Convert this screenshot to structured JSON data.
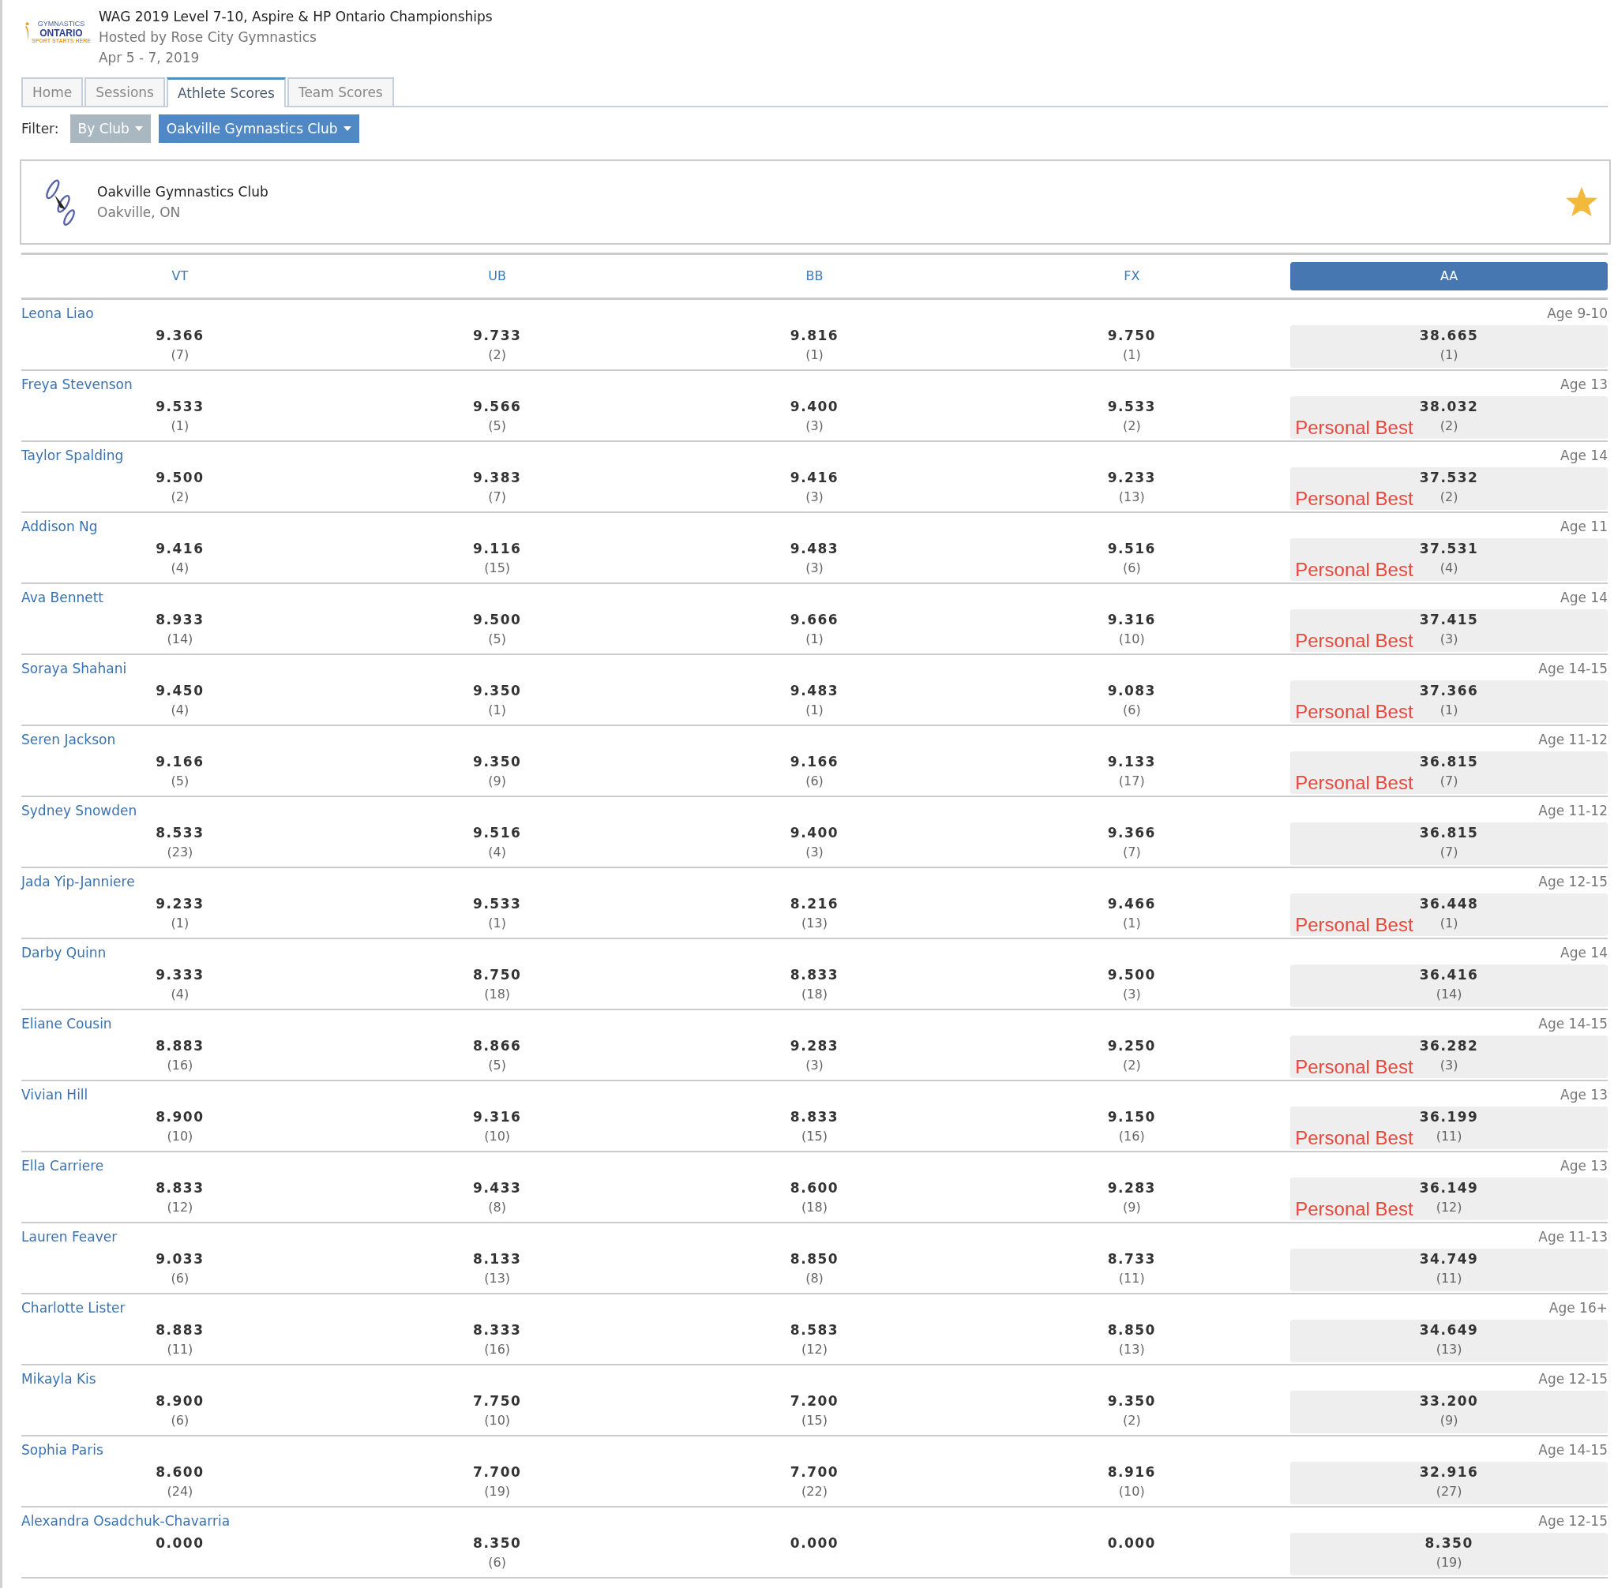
{
  "header": {
    "logo_lines": [
      "GYMNASTICS",
      "ONTARIO",
      "SPORT STARTS HERE"
    ],
    "title": "WAG 2019 Level 7-10, Aspire & HP Ontario Championships",
    "host": "Hosted by Rose City Gymnastics",
    "dates": "Apr 5 - 7, 2019"
  },
  "tabs": [
    {
      "label": "Home",
      "selected": false
    },
    {
      "label": "Sessions",
      "selected": false
    },
    {
      "label": "Athlete Scores",
      "selected": true
    },
    {
      "label": "Team Scores",
      "selected": false
    }
  ],
  "filter": {
    "label": "Filter:",
    "buttons": [
      {
        "label": "By Club",
        "kind": "secondary"
      },
      {
        "label": "Oakville Gymnastics Club",
        "kind": "primary"
      }
    ]
  },
  "club": {
    "name": "Oakville Gymnastics Club",
    "location": "Oakville, ON",
    "favorite": true
  },
  "columns": [
    {
      "label": "VT",
      "selected": false
    },
    {
      "label": "UB",
      "selected": false
    },
    {
      "label": "BB",
      "selected": false
    },
    {
      "label": "FX",
      "selected": false
    },
    {
      "label": "AA",
      "selected": true
    }
  ],
  "rows": [
    {
      "name": "Leona Liao",
      "age": "Age 9-10",
      "scores": [
        {
          "score": "9.366",
          "rank": "(7)"
        },
        {
          "score": "9.733",
          "rank": "(2)"
        },
        {
          "score": "9.816",
          "rank": "(1)"
        },
        {
          "score": "9.750",
          "rank": "(1)"
        }
      ],
      "aa": {
        "score": "38.665",
        "rank": "(1)"
      }
    },
    {
      "name": "Freya Stevenson",
      "age": "Age 13",
      "scores": [
        {
          "score": "9.533",
          "rank": "(1)"
        },
        {
          "score": "9.566",
          "rank": "(5)"
        },
        {
          "score": "9.400",
          "rank": "(3)"
        },
        {
          "score": "9.533",
          "rank": "(2)"
        }
      ],
      "aa": {
        "score": "38.032",
        "rank": "(2)"
      },
      "badge": "Personal Best"
    },
    {
      "name": "Taylor Spalding",
      "age": "Age 14",
      "scores": [
        {
          "score": "9.500",
          "rank": "(2)"
        },
        {
          "score": "9.383",
          "rank": "(7)"
        },
        {
          "score": "9.416",
          "rank": "(3)"
        },
        {
          "score": "9.233",
          "rank": "(13)"
        }
      ],
      "aa": {
        "score": "37.532",
        "rank": "(2)"
      },
      "badge": "Personal Best"
    },
    {
      "name": "Addison Ng",
      "age": "Age 11",
      "scores": [
        {
          "score": "9.416",
          "rank": "(4)"
        },
        {
          "score": "9.116",
          "rank": "(15)"
        },
        {
          "score": "9.483",
          "rank": "(3)"
        },
        {
          "score": "9.516",
          "rank": "(6)"
        }
      ],
      "aa": {
        "score": "37.531",
        "rank": "(4)"
      },
      "badge": "Personal Best"
    },
    {
      "name": "Ava Bennett",
      "age": "Age 14",
      "scores": [
        {
          "score": "8.933",
          "rank": "(14)"
        },
        {
          "score": "9.500",
          "rank": "(5)"
        },
        {
          "score": "9.666",
          "rank": "(1)"
        },
        {
          "score": "9.316",
          "rank": "(10)"
        }
      ],
      "aa": {
        "score": "37.415",
        "rank": "(3)"
      },
      "badge": "Personal Best"
    },
    {
      "name": "Soraya Shahani",
      "age": "Age 14-15",
      "scores": [
        {
          "score": "9.450",
          "rank": "(4)"
        },
        {
          "score": "9.350",
          "rank": "(1)"
        },
        {
          "score": "9.483",
          "rank": "(1)"
        },
        {
          "score": "9.083",
          "rank": "(6)"
        }
      ],
      "aa": {
        "score": "37.366",
        "rank": "(1)"
      },
      "badge": "Personal Best"
    },
    {
      "name": "Seren Jackson",
      "age": "Age 11-12",
      "scores": [
        {
          "score": "9.166",
          "rank": "(5)"
        },
        {
          "score": "9.350",
          "rank": "(9)"
        },
        {
          "score": "9.166",
          "rank": "(6)"
        },
        {
          "score": "9.133",
          "rank": "(17)"
        }
      ],
      "aa": {
        "score": "36.815",
        "rank": "(7)"
      },
      "badge": "Personal Best"
    },
    {
      "name": "Sydney Snowden",
      "age": "Age 11-12",
      "scores": [
        {
          "score": "8.533",
          "rank": "(23)"
        },
        {
          "score": "9.516",
          "rank": "(4)"
        },
        {
          "score": "9.400",
          "rank": "(3)"
        },
        {
          "score": "9.366",
          "rank": "(7)"
        }
      ],
      "aa": {
        "score": "36.815",
        "rank": "(7)"
      }
    },
    {
      "name": "Jada Yip-Janniere",
      "age": "Age 12-15",
      "scores": [
        {
          "score": "9.233",
          "rank": "(1)"
        },
        {
          "score": "9.533",
          "rank": "(1)"
        },
        {
          "score": "8.216",
          "rank": "(13)"
        },
        {
          "score": "9.466",
          "rank": "(1)"
        }
      ],
      "aa": {
        "score": "36.448",
        "rank": "(1)"
      },
      "badge": "Personal Best"
    },
    {
      "name": "Darby Quinn",
      "age": "Age 14",
      "scores": [
        {
          "score": "9.333",
          "rank": "(4)"
        },
        {
          "score": "8.750",
          "rank": "(18)"
        },
        {
          "score": "8.833",
          "rank": "(18)"
        },
        {
          "score": "9.500",
          "rank": "(3)"
        }
      ],
      "aa": {
        "score": "36.416",
        "rank": "(14)"
      }
    },
    {
      "name": "Eliane Cousin",
      "age": "Age 14-15",
      "scores": [
        {
          "score": "8.883",
          "rank": "(16)"
        },
        {
          "score": "8.866",
          "rank": "(5)"
        },
        {
          "score": "9.283",
          "rank": "(3)"
        },
        {
          "score": "9.250",
          "rank": "(2)"
        }
      ],
      "aa": {
        "score": "36.282",
        "rank": "(3)"
      },
      "badge": "Personal Best"
    },
    {
      "name": "Vivian Hill",
      "age": "Age 13",
      "scores": [
        {
          "score": "8.900",
          "rank": "(10)"
        },
        {
          "score": "9.316",
          "rank": "(10)"
        },
        {
          "score": "8.833",
          "rank": "(15)"
        },
        {
          "score": "9.150",
          "rank": "(16)"
        }
      ],
      "aa": {
        "score": "36.199",
        "rank": "(11)"
      },
      "badge": "Personal Best"
    },
    {
      "name": "Ella Carriere",
      "age": "Age 13",
      "scores": [
        {
          "score": "8.833",
          "rank": "(12)"
        },
        {
          "score": "9.433",
          "rank": "(8)"
        },
        {
          "score": "8.600",
          "rank": "(18)"
        },
        {
          "score": "9.283",
          "rank": "(9)"
        }
      ],
      "aa": {
        "score": "36.149",
        "rank": "(12)"
      },
      "badge": "Personal Best"
    },
    {
      "name": "Lauren Feaver",
      "age": "Age 11-13",
      "scores": [
        {
          "score": "9.033",
          "rank": "(6)"
        },
        {
          "score": "8.133",
          "rank": "(13)"
        },
        {
          "score": "8.850",
          "rank": "(8)"
        },
        {
          "score": "8.733",
          "rank": "(11)"
        }
      ],
      "aa": {
        "score": "34.749",
        "rank": "(11)"
      }
    },
    {
      "name": "Charlotte Lister",
      "age": "Age 16+",
      "scores": [
        {
          "score": "8.883",
          "rank": "(11)"
        },
        {
          "score": "8.333",
          "rank": "(16)"
        },
        {
          "score": "8.583",
          "rank": "(12)"
        },
        {
          "score": "8.850",
          "rank": "(13)"
        }
      ],
      "aa": {
        "score": "34.649",
        "rank": "(13)"
      }
    },
    {
      "name": "Mikayla Kis",
      "age": "Age 12-15",
      "scores": [
        {
          "score": "8.900",
          "rank": "(6)"
        },
        {
          "score": "7.750",
          "rank": "(10)"
        },
        {
          "score": "7.200",
          "rank": "(15)"
        },
        {
          "score": "9.350",
          "rank": "(2)"
        }
      ],
      "aa": {
        "score": "33.200",
        "rank": "(9)"
      }
    },
    {
      "name": "Sophia Paris",
      "age": "Age 14-15",
      "scores": [
        {
          "score": "8.600",
          "rank": "(24)"
        },
        {
          "score": "7.700",
          "rank": "(19)"
        },
        {
          "score": "7.700",
          "rank": "(22)"
        },
        {
          "score": "8.916",
          "rank": "(10)"
        }
      ],
      "aa": {
        "score": "32.916",
        "rank": "(27)"
      }
    },
    {
      "name": "Alexandra Osadchuk-Chavarria",
      "age": "Age 12-15",
      "scores": [
        {
          "score": "0.000"
        },
        {
          "score": "8.350",
          "rank": "(6)"
        },
        {
          "score": "0.000"
        },
        {
          "score": "0.000"
        }
      ],
      "aa": {
        "score": "8.350",
        "rank": "(19)"
      }
    }
  ]
}
